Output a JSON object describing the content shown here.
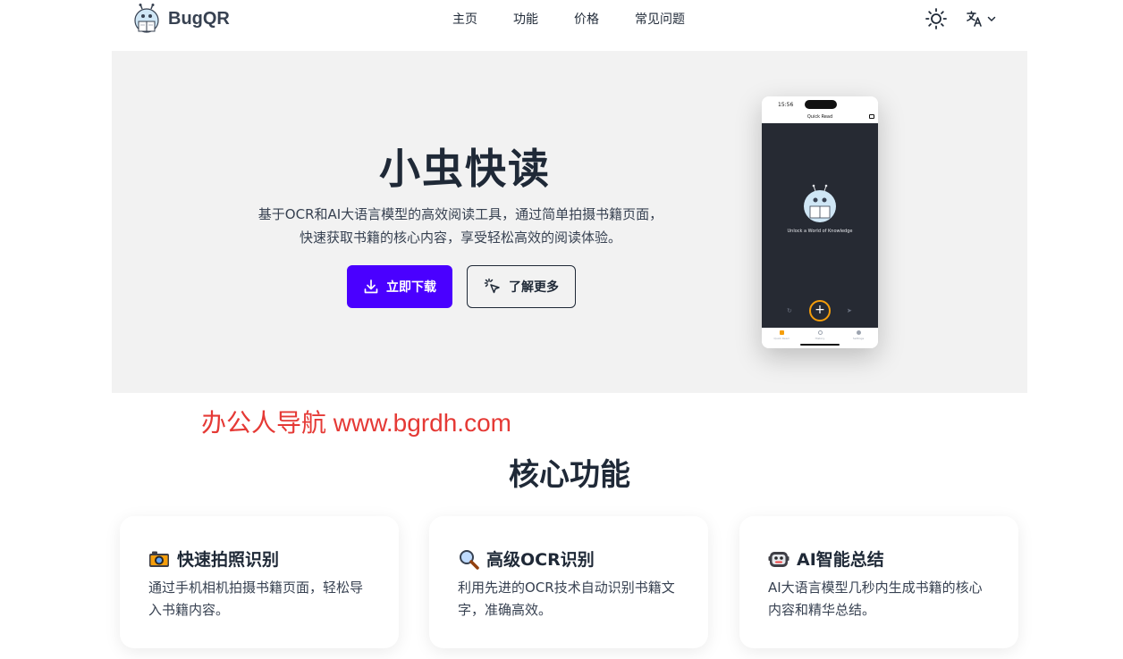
{
  "brand": {
    "name": "BugQR"
  },
  "nav": {
    "items": [
      {
        "label": "主页"
      },
      {
        "label": "功能"
      },
      {
        "label": "价格"
      },
      {
        "label": "常见问题"
      }
    ]
  },
  "hero": {
    "title": "小虫快读",
    "description": "基于OCR和AI大语言模型的高效阅读工具，通过简单拍摄书籍页面，快速获取书籍的核心内容，享受轻松高效的阅读体验。",
    "download_label": "立即下载",
    "learn_more_label": "了解更多"
  },
  "phone": {
    "time": "15:56",
    "title": "Quick Read",
    "tagline": "Unlock a World of Knowledge",
    "tabs": [
      {
        "label": "Quick Read"
      },
      {
        "label": "History"
      },
      {
        "label": "Settings"
      }
    ]
  },
  "watermark": "办公人导航  www.bgrdh.com",
  "features": {
    "title": "核心功能",
    "cards": [
      {
        "icon": "camera-icon",
        "title": "快速拍照识别",
        "description": "通过手机相机拍摄书籍页面，轻松导入书籍内容。"
      },
      {
        "icon": "magnifier-icon",
        "title": "高级OCR识别",
        "description": "利用先进的OCR技术自动识别书籍文字，准确高效。"
      },
      {
        "icon": "robot-icon",
        "title": "AI智能总结",
        "description": "AI大语言模型几秒内生成书籍的核心内容和精华总结。"
      }
    ]
  },
  "colors": {
    "primary": "#4a00ff",
    "hero_bg": "#f2f2f2",
    "watermark": "#e53935",
    "phone_screen": "#262a33"
  }
}
